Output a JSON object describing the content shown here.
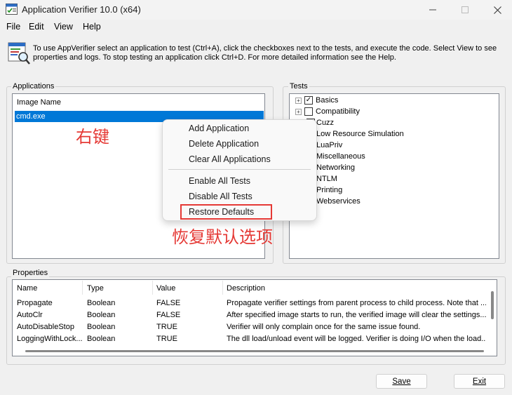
{
  "window": {
    "title": "Application Verifier 10.0 (x64)",
    "minimize_icon": "minimize-icon",
    "maximize_icon": "maximize-icon",
    "close_icon": "close-icon"
  },
  "menu": [
    "File",
    "Edit",
    "View",
    "Help"
  ],
  "info": {
    "text": "To use AppVerifier select an application to test (Ctrl+A), click the checkboxes next to the tests, and execute the code. Select View to see properties and logs. To stop testing an application click Ctrl+D. For more detailed information see the Help."
  },
  "applications": {
    "label": "Applications",
    "column": "Image Name",
    "rows": [
      "cmd.exe"
    ]
  },
  "tests": {
    "label": "Tests",
    "items": [
      {
        "label": "Basics",
        "expandable": true,
        "checkbox": true,
        "checked": true
      },
      {
        "label": "Compatibility",
        "expandable": true,
        "checkbox": true,
        "checked": false
      },
      {
        "label": "Cuzz",
        "expandable": false,
        "checkbox": true,
        "checked": false
      },
      {
        "label": "Low Resource Simulation",
        "expandable": false,
        "checkbox": true,
        "checked": false
      },
      {
        "label": "LuaPriv",
        "expandable": false,
        "checkbox": true,
        "checked": false
      },
      {
        "label": "Miscellaneous",
        "expandable": false,
        "checkbox": true,
        "checked": false
      },
      {
        "label": "Networking",
        "expandable": false,
        "checkbox": true,
        "checked": false
      },
      {
        "label": "NTLM",
        "expandable": false,
        "checkbox": true,
        "checked": false
      },
      {
        "label": "Printing",
        "expandable": false,
        "checkbox": true,
        "checked": false
      },
      {
        "label": "Webservices",
        "expandable": false,
        "checkbox": true,
        "checked": false
      }
    ]
  },
  "properties": {
    "label": "Properties",
    "columns": [
      "Name",
      "Type",
      "Value",
      "Description"
    ],
    "rows": [
      [
        "Propagate",
        "Boolean",
        "FALSE",
        "Propagate verifier settings from parent process to child process. Note that ..."
      ],
      [
        "AutoClr",
        "Boolean",
        "FALSE",
        "After specified image starts to run, the verified image will clear the settings..."
      ],
      [
        "AutoDisableStop",
        "Boolean",
        "TRUE",
        "Verifier will only complain once for the same issue found."
      ],
      [
        "LoggingWithLock...",
        "Boolean",
        "TRUE",
        "The dll load/unload event will be logged. Verifier is doing I/O when the load..."
      ]
    ]
  },
  "buttons": {
    "save": "Save",
    "exit": "Exit"
  },
  "context_menu": {
    "items": [
      "Add Application",
      "Delete Application",
      "Clear All Applications",
      "Enable All Tests",
      "Disable All Tests",
      "Restore Defaults"
    ]
  },
  "annotations": {
    "right_click": "右键",
    "restore_defaults": "恢复默认选项",
    "color": "#e53935"
  },
  "colors": {
    "selection": "#0078d7",
    "annotation": "#e53935"
  }
}
